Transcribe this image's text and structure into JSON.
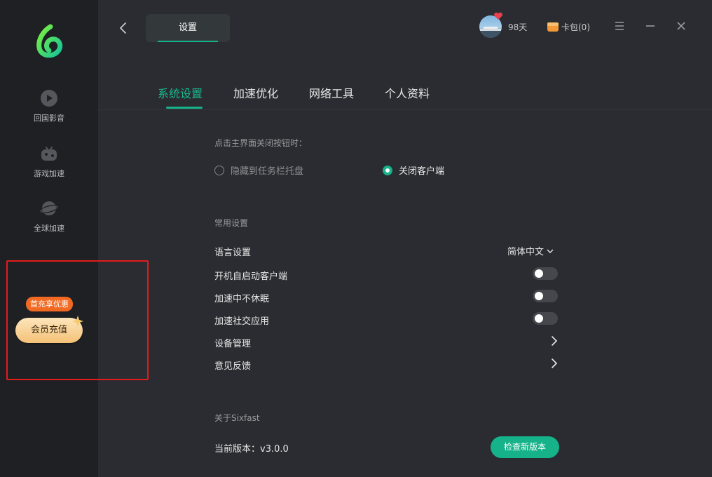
{
  "sidebar": {
    "items": [
      {
        "label": "回国影音",
        "icon": "play-circle-icon"
      },
      {
        "label": "游戏加速",
        "icon": "gamepad-icon"
      },
      {
        "label": "全球加速",
        "icon": "planet-icon"
      }
    ],
    "promo_badge": "首充享优惠",
    "recharge_label": "会员充值"
  },
  "header": {
    "title": "设置",
    "days": "98天",
    "wallet": "卡包(0)"
  },
  "tabs": [
    {
      "label": "系统设置",
      "active": true
    },
    {
      "label": "加速优化",
      "active": false
    },
    {
      "label": "网络工具",
      "active": false
    },
    {
      "label": "个人资料",
      "active": false
    }
  ],
  "close_behavior": {
    "label": "点击主界面关闭按钮时：",
    "options": [
      {
        "label": "隐藏到任务栏托盘",
        "selected": false
      },
      {
        "label": "关闭客户端",
        "selected": true
      }
    ]
  },
  "common": {
    "label": "常用设置",
    "language": {
      "label": "语言设置",
      "value": "简体中文"
    },
    "toggles": [
      {
        "label": "开机自启动客户端",
        "on": false
      },
      {
        "label": "加速中不休眠",
        "on": false
      },
      {
        "label": "加速社交应用",
        "on": false
      }
    ],
    "links": [
      {
        "label": "设备管理"
      },
      {
        "label": "意见反馈"
      }
    ]
  },
  "about": {
    "label": "关于Sixfast",
    "version_text": "当前版本：v3.0.0",
    "check_button": "检查新版本"
  },
  "colors": {
    "accent": "#16b28a",
    "sidebar_bg": "#1f2024",
    "content_bg": "#2a2c31",
    "promo_border": "#e21b1b",
    "badge": "#f26a22"
  }
}
